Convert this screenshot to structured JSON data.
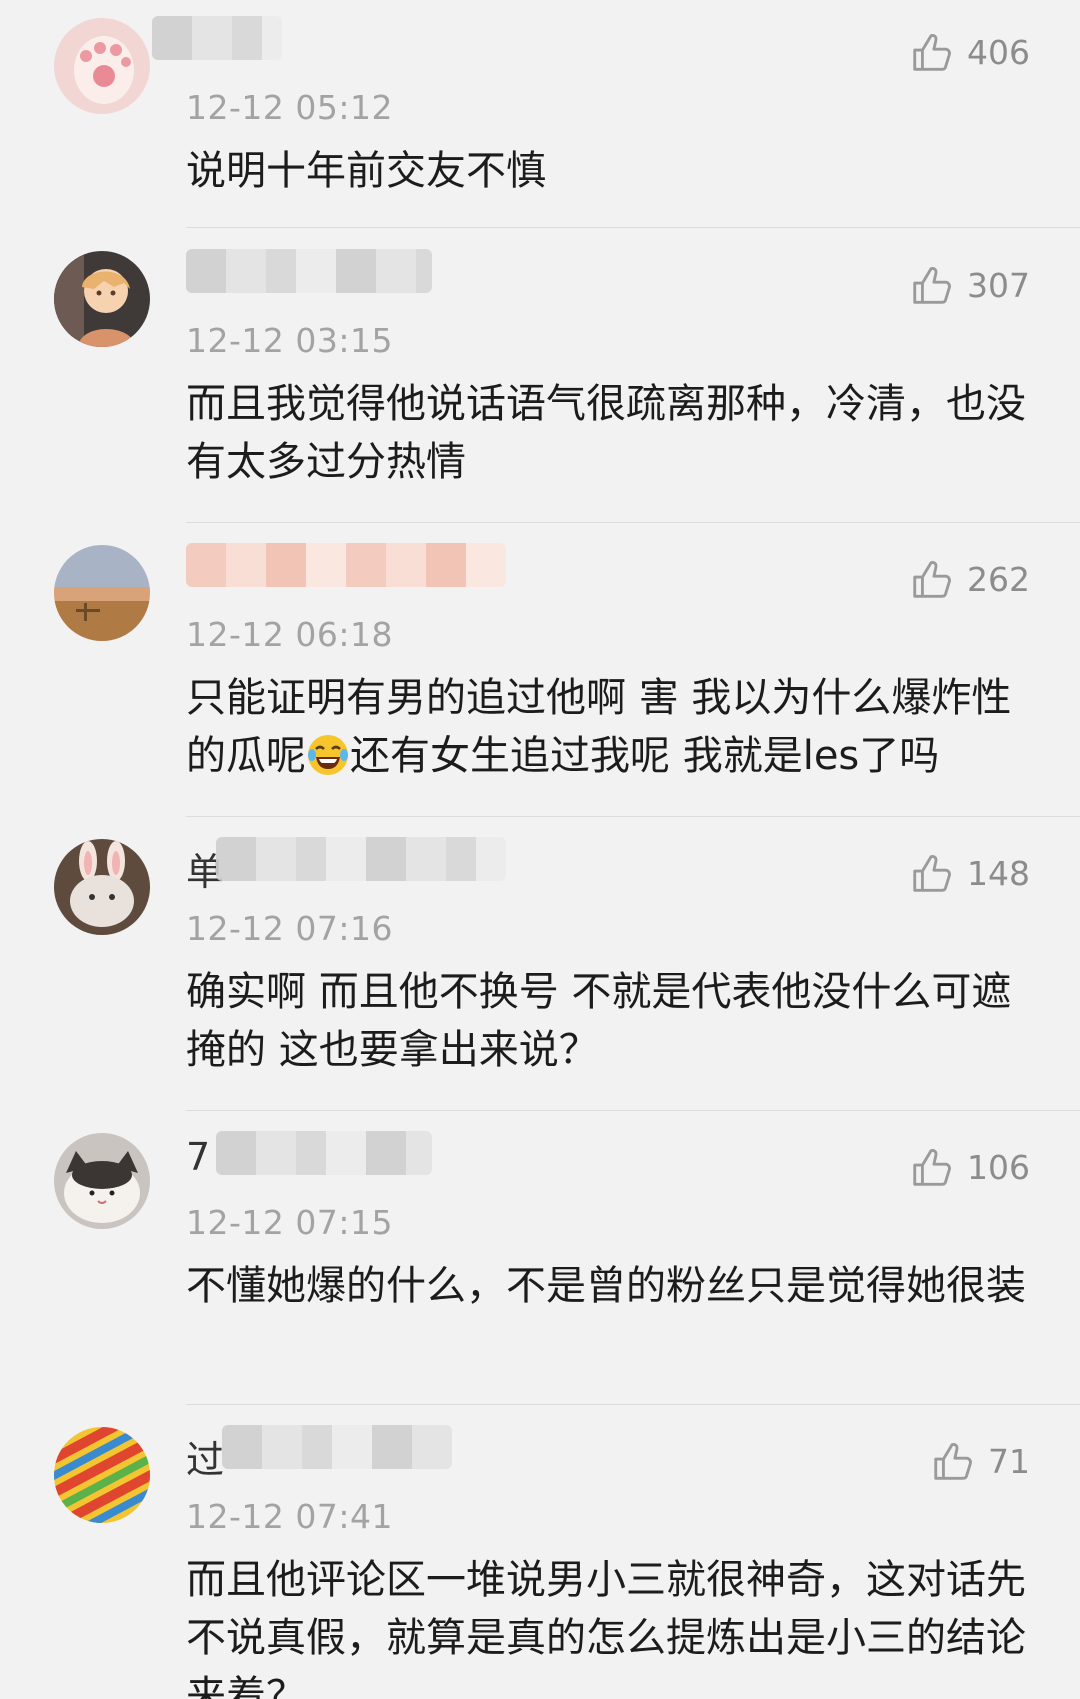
{
  "comments": [
    {
      "username_lead": "",
      "timestamp": "12-12 05:12",
      "likes": "406",
      "text": "说明十年前交友不慎"
    },
    {
      "username_lead": "",
      "timestamp": "12-12 03:15",
      "likes": "307",
      "text": "而且我觉得他说话语气很疏离那种，冷清，也没有太多过分热情"
    },
    {
      "username_lead": "",
      "timestamp": "12-12 06:18",
      "likes": "262",
      "text_before_emoji": "只能证明有男的追过他啊 害 我以为什么爆炸性的瓜呢",
      "emoji": "laughing-tears",
      "text_after_emoji": "还有女生追过我呢 我就是les了吗"
    },
    {
      "username_lead": "单",
      "timestamp": "12-12 07:16",
      "likes": "148",
      "text": "确实啊  而且他不换号 不就是代表他没什么可遮掩的 这也要拿出来说？"
    },
    {
      "username_lead": "7",
      "timestamp": "12-12 07:15",
      "likes": "106",
      "text": "不懂她爆的什么，不是曾的粉丝只是觉得她很装"
    },
    {
      "username_lead": "过",
      "timestamp": "12-12 07:41",
      "likes": "71",
      "text": "而且他评论区一堆说男小三就很神奇，这对话先不说真假，就算是真的怎么提炼出是小三的结论来着？"
    }
  ],
  "icons": {
    "like": "thumbs-up-icon"
  },
  "colors": {
    "background": "#f2f2f2",
    "timestamp": "#a3a3a3",
    "likes": "#8c8c8c",
    "text": "#1c1c1c"
  }
}
